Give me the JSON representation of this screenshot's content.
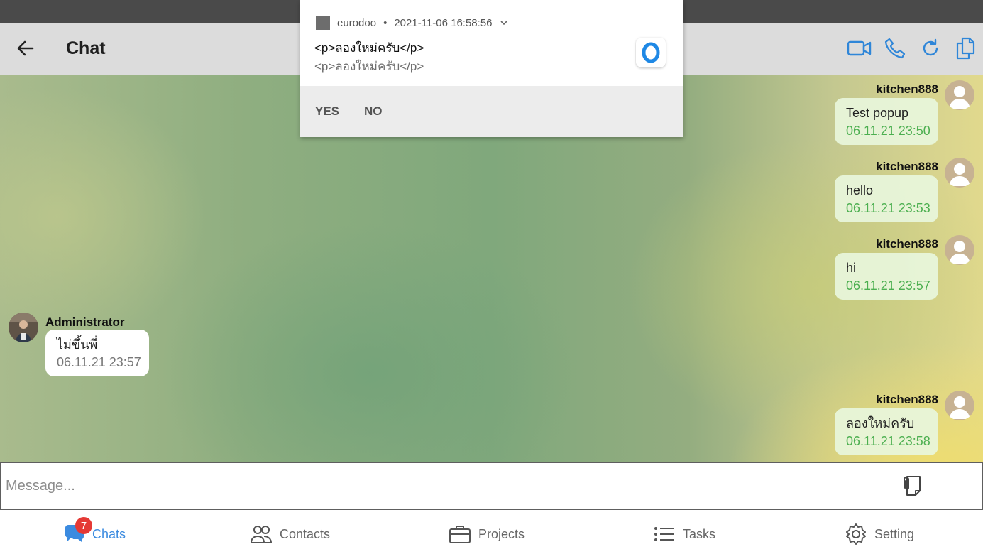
{
  "appbar": {
    "title": "Chat",
    "icons": [
      "back-arrow-icon",
      "video-call-icon",
      "phone-icon",
      "refresh-icon",
      "copy-icon"
    ]
  },
  "notification": {
    "app_name": "eurodoo",
    "timestamp": "2021-11-06 16:58:56",
    "title": "<p>ลองใหม่ครับ</p>",
    "body": "<p>ลองใหม่ครับ</p>",
    "yes_label": "YES",
    "no_label": "NO",
    "accent": "#1e88e5"
  },
  "messages": [
    {
      "sender": "kitchen888",
      "text": "Test popup",
      "time": "06.11.21 23:50",
      "direction": "out"
    },
    {
      "sender": "kitchen888",
      "text": "hello",
      "time": "06.11.21 23:53",
      "direction": "out"
    },
    {
      "sender": "kitchen888",
      "text": "hi",
      "time": "06.11.21 23:57",
      "direction": "out"
    },
    {
      "sender": "Administrator",
      "text": "ไม่ขึ้นพี่",
      "time": "06.11.21 23:57",
      "direction": "in"
    },
    {
      "sender": "kitchen888",
      "text": "ลองใหม่ครับ",
      "time": "06.11.21 23:58",
      "direction": "out"
    }
  ],
  "composer": {
    "placeholder": "Message...",
    "value": ""
  },
  "nav": {
    "chats": {
      "label": "Chats",
      "badge": "7"
    },
    "contacts": {
      "label": "Contacts"
    },
    "projects": {
      "label": "Projects"
    },
    "tasks": {
      "label": "Tasks"
    },
    "setting": {
      "label": "Setting"
    },
    "active_color": "#3b8be0"
  }
}
